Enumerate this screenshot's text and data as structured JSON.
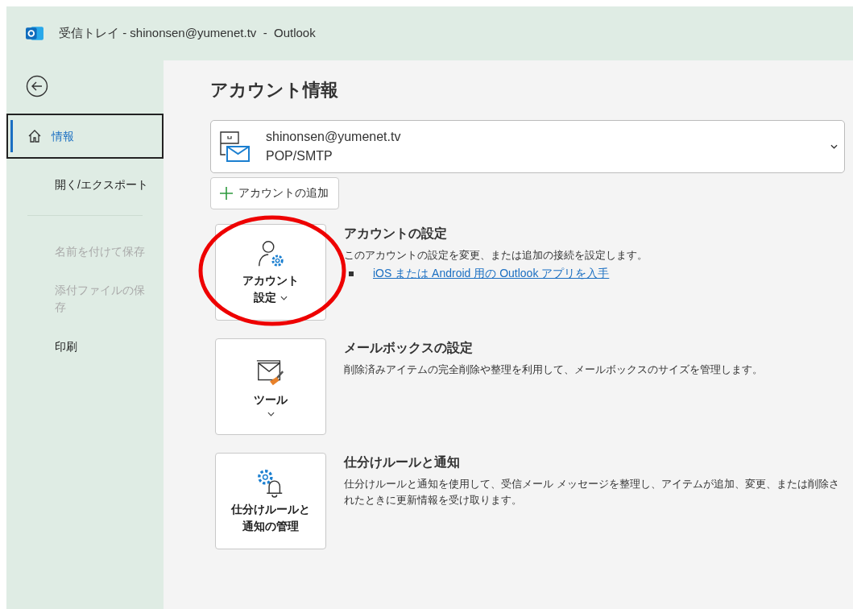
{
  "window": {
    "title": "受信トレイ - shinonsen@yumenet.tv  -  Outlook"
  },
  "sidebar": {
    "items": [
      {
        "kind": "home",
        "label": "情報",
        "selected": true,
        "disabled": false
      },
      {
        "kind": "item",
        "label": "開く/エクスポート",
        "selected": false,
        "disabled": false
      },
      {
        "kind": "divider"
      },
      {
        "kind": "item",
        "label": "名前を付けて保存",
        "selected": false,
        "disabled": true
      },
      {
        "kind": "item",
        "label": "添付ファイルの保存",
        "selected": false,
        "disabled": true
      },
      {
        "kind": "item",
        "label": "印刷",
        "selected": false,
        "disabled": false
      }
    ]
  },
  "heading": "アカウント情報",
  "account": {
    "email": "shinonsen@yumenet.tv",
    "type": "POP/SMTP"
  },
  "add_account": "アカウントの追加",
  "sections": [
    {
      "kind": "account",
      "button_lines": [
        "アカウント",
        "設定"
      ],
      "highlighted": true,
      "title": "アカウントの設定",
      "description": "このアカウントの設定を変更、または追加の接続を設定します。",
      "links": [
        "iOS または Android 用の Outlook アプリを入手"
      ]
    },
    {
      "kind": "tools",
      "button_lines": [
        "ツール"
      ],
      "highlighted": false,
      "title": "メールボックスの設定",
      "description": "削除済みアイテムの完全削除や整理を利用して、メールボックスのサイズを管理します。"
    },
    {
      "kind": "rules",
      "button_lines": [
        "仕分けルールと",
        "通知の管理"
      ],
      "highlighted": false,
      "title": "仕分けルールと通知",
      "description": "仕分けルールと通知を使用して、受信メール メッセージを整理し、アイテムが追加、変更、または削除されたときに更新情報を受け取ります。"
    }
  ]
}
